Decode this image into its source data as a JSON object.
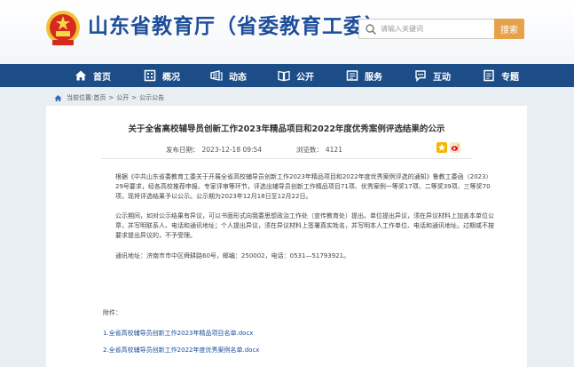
{
  "header": {
    "site_title": "山东省教育厅（省委教育工委）",
    "search": {
      "placeholder": "请输入关键词",
      "button_label": "搜索"
    }
  },
  "nav": {
    "items": [
      {
        "label": "首页",
        "icon": "home-icon"
      },
      {
        "label": "概况",
        "icon": "building-icon"
      },
      {
        "label": "动态",
        "icon": "news-icon"
      },
      {
        "label": "公开",
        "icon": "book-icon"
      },
      {
        "label": "服务",
        "icon": "service-icon"
      },
      {
        "label": "互动",
        "icon": "chat-icon"
      },
      {
        "label": "专题",
        "icon": "topic-icon"
      }
    ]
  },
  "breadcrumb": {
    "prefix": "当前位置:",
    "items": [
      "首页",
      "公开",
      "公示公告"
    ],
    "sep": ">"
  },
  "article": {
    "title": "关于全省高校辅导员创新工作2023年精品项目和2022年度优秀案例评选结果的公示",
    "publish_label": "发布日期：",
    "publish_date": "2023-12-18 09:54",
    "views_label": "浏览数：",
    "views": "4121",
    "paragraphs": [
      "根据《中共山东省委教育工委关于开展全省高校辅导员创新工作2023年精品项目和2022年度优秀案例评选的通知》鲁教工委函（2023）29号要求，经各高校推荐申报、专家评审等环节，评选出辅导员创新工作精品项目71项、优秀案例一等奖17项、二等奖39项、三等奖70项，现将评选结果予以公示。公示期为2023年12月18日至12月22日。",
      "公示期间，如对公示结果有异议，可以书面形式向我委思想政治工作处（宣传教育处）提出。单位提出异议，须在异议材料上加盖本单位公章，并写明联系人、电话和通讯地址；个人提出异议，须在异议材料上签署真实姓名，并写明本人工作单位、电话和通讯地址。过期或不按要求提出异议的，不予受理。",
      "通讯地址：济南市市中区舜耕路60号，邮编：250002，电话：0531—51793921。"
    ],
    "attachments_label": "附件：",
    "attachments": [
      "1.全省高校辅导员创新工作2023年精品项目名单.docx",
      "2.全省高校辅导员创新工作2022年度优秀案例名单.docx"
    ]
  },
  "colors": {
    "brand": "#1d4e9a",
    "nav_bg": "#1c4d87",
    "search_button": "#e6a24a"
  }
}
